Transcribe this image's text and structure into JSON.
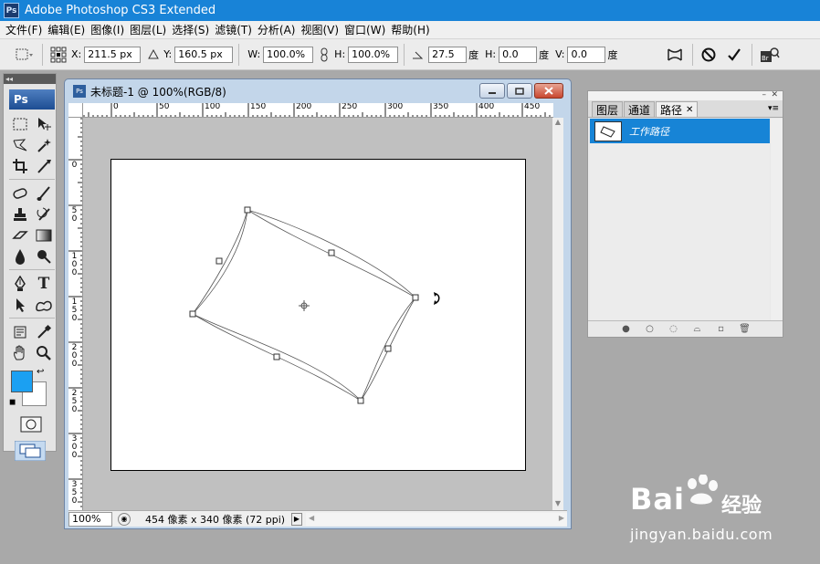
{
  "app": {
    "title": "Adobe Photoshop CS3 Extended",
    "logo_text": "Ps"
  },
  "menu": [
    "文件(F)",
    "编辑(E)",
    "图像(I)",
    "图层(L)",
    "选择(S)",
    "滤镜(T)",
    "分析(A)",
    "视图(V)",
    "窗口(W)",
    "帮助(H)"
  ],
  "options": {
    "x_label": "X:",
    "x_value": "211.5 px",
    "y_label": "Y:",
    "y_value": "160.5 px",
    "w_label": "W:",
    "w_value": "100.0%",
    "h_label": "H:",
    "h_value": "100.0%",
    "angle_value": "27.5",
    "angle_unit": "度",
    "hskew_label": "H:",
    "hskew_value": "0.0",
    "hskew_unit": "度",
    "vskew_label": "V:",
    "vskew_value": "0.0",
    "vskew_unit": "度"
  },
  "toolbox": {
    "badge": "Ps",
    "fg_color": "#1ba0f2",
    "bg_color": "#ffffff"
  },
  "document": {
    "title": "未标题-1 @ 100%(RGB/8)",
    "ruler_h": [
      "0",
      "50",
      "100",
      "150",
      "200",
      "250",
      "300",
      "350",
      "400",
      "450"
    ],
    "ruler_v": [
      "0",
      "50",
      "100",
      "150",
      "200",
      "250",
      "300",
      "350"
    ],
    "zoom": "100%",
    "info": "454 像素 x 340 像素 (72 ppi)"
  },
  "panel": {
    "tabs": [
      "图层",
      "通道",
      "路径"
    ],
    "active_tab": "路径",
    "path_name": "工作路径"
  },
  "watermark": {
    "logo": "Bai",
    "logo_tail": "经验",
    "url": "jingyan.baidu.com"
  }
}
